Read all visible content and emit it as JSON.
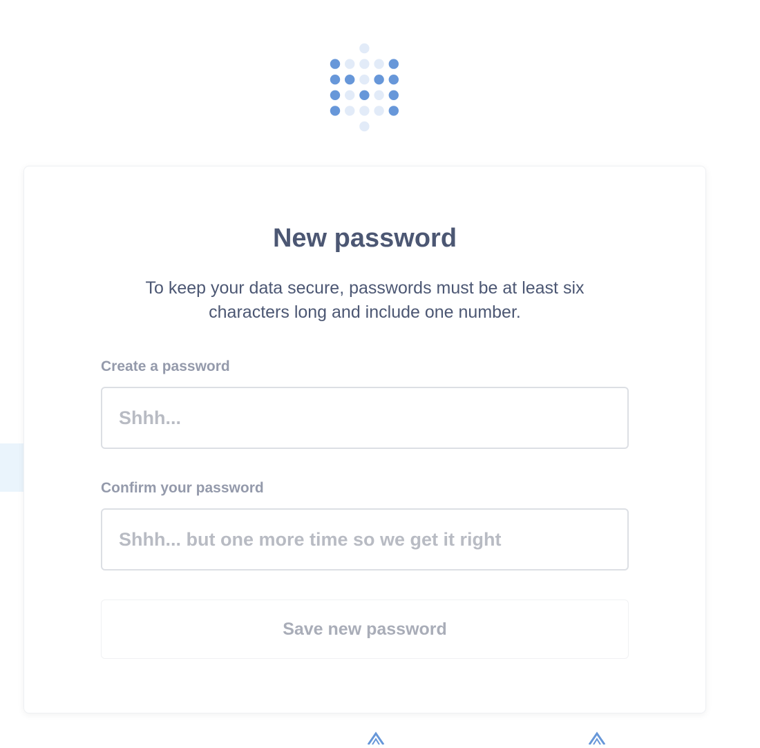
{
  "brand": {
    "logo_icon": "metabase-dots-logo-icon",
    "dot_dark_color": "#6797d9",
    "dot_light_color": "#e2ebf8"
  },
  "form": {
    "title": "New password",
    "subtitle": "To keep your data secure, passwords must be at least six characters long and include one number.",
    "password_label": "Create a password",
    "password_value": "",
    "password_placeholder": "Shhh...",
    "confirm_label": "Confirm your password",
    "confirm_value": "",
    "confirm_placeholder": "Shhh... but one more time so we get it right",
    "submit_label": "Save new password",
    "submit_enabled": false
  },
  "decorations": {
    "bottom_icons": [
      "caret-up-icon",
      "caret-up-icon"
    ],
    "accent_color": "#6797d9",
    "background_blob_color": "#eaf4fc"
  }
}
